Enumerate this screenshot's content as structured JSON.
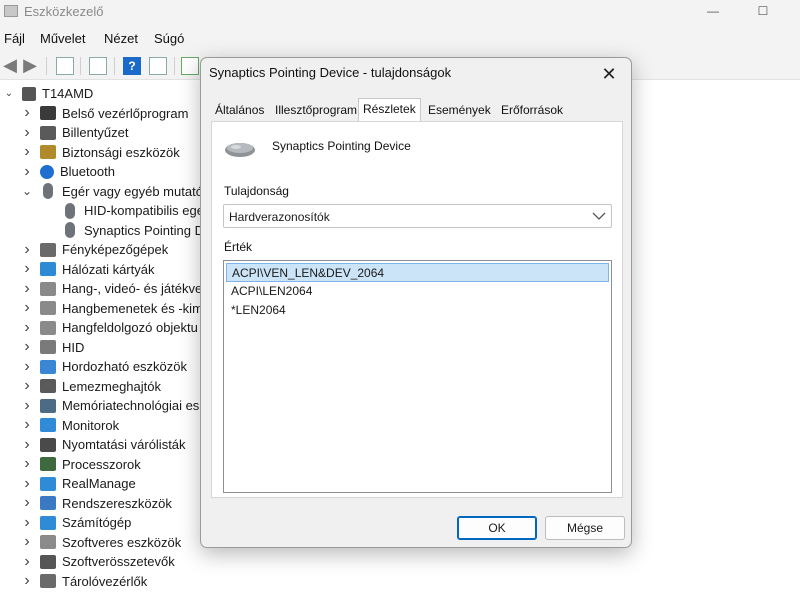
{
  "app": {
    "title": "Eszközkezelő"
  },
  "window_controls": {
    "minimize": "—",
    "maximize": "☐"
  },
  "menu": [
    "Fájl",
    "Művelet",
    "Nézet",
    "Súgó"
  ],
  "toolbar": {
    "help": "?"
  },
  "tree": {
    "root": "T14AMD",
    "items": [
      {
        "label": "Belső vezérlőprogram",
        "expanded": false,
        "icon": "firmware-icon"
      },
      {
        "label": "Billentyűzet",
        "expanded": false,
        "icon": "keyboard-icon"
      },
      {
        "label": "Biztonsági eszközök",
        "expanded": false,
        "icon": "security-device-icon"
      },
      {
        "label": "Bluetooth",
        "expanded": false,
        "icon": "bluetooth-icon"
      },
      {
        "label": "Egér vagy egyéb mutató",
        "expanded": true,
        "icon": "mouse-icon"
      },
      {
        "label": "HID-kompatibilis ege",
        "child": true,
        "icon": "mouse-icon"
      },
      {
        "label": "Synaptics Pointing D",
        "child": true,
        "icon": "mouse-icon"
      },
      {
        "label": "Fényképezőgépek",
        "expanded": false,
        "icon": "camera-icon"
      },
      {
        "label": "Hálózati kártyák",
        "expanded": false,
        "icon": "network-adapter-icon"
      },
      {
        "label": "Hang-, videó- és játékve",
        "expanded": false,
        "icon": "speaker-icon"
      },
      {
        "label": "Hangbemenetek és -kim",
        "expanded": false,
        "icon": "speaker-icon"
      },
      {
        "label": "Hangfeldolgozó objektu",
        "expanded": false,
        "icon": "speaker-icon"
      },
      {
        "label": "HID",
        "expanded": false,
        "icon": "hid-icon"
      },
      {
        "label": "Hordozható eszközök",
        "expanded": false,
        "icon": "portable-device-icon"
      },
      {
        "label": "Lemezmeghajtók",
        "expanded": false,
        "icon": "disk-drive-icon"
      },
      {
        "label": "Memóriatechnológiai es",
        "expanded": false,
        "icon": "memory-icon"
      },
      {
        "label": "Monitorok",
        "expanded": false,
        "icon": "monitor-icon"
      },
      {
        "label": "Nyomtatási várólisták",
        "expanded": false,
        "icon": "printer-icon"
      },
      {
        "label": "Processzorok",
        "expanded": false,
        "icon": "processor-icon"
      },
      {
        "label": "RealManage",
        "expanded": false,
        "icon": "monitor-icon"
      },
      {
        "label": "Rendszereszközök",
        "expanded": false,
        "icon": "system-device-icon"
      },
      {
        "label": "Számítógép",
        "expanded": false,
        "icon": "computer-icon"
      },
      {
        "label": "Szoftveres eszközök",
        "expanded": false,
        "icon": "software-device-icon"
      },
      {
        "label": "Szoftverösszetevők",
        "expanded": false,
        "icon": "software-component-icon"
      },
      {
        "label": "Tárolóvezérlők",
        "expanded": false,
        "icon": "storage-controller-icon"
      }
    ]
  },
  "dialog": {
    "title": "Synaptics Pointing Device - tulajdonságok",
    "close": "✕",
    "tabs": [
      "Általános",
      "Illesztőprogram",
      "Részletek",
      "Események",
      "Erőforrások"
    ],
    "active_tab": "Részletek",
    "device_name": "Synaptics Pointing Device",
    "property_label": "Tulajdonság",
    "property_value": "Hardverazonosítók",
    "value_label": "Érték",
    "values": [
      "ACPI\\VEN_LEN&DEV_2064",
      "ACPI\\LEN2064",
      "*LEN2064"
    ],
    "selected_value_index": 0,
    "ok": "OK",
    "cancel": "Mégse"
  },
  "colors": {
    "accent": "#0067c0",
    "selection": "#cce4f7",
    "window_bg": "#f0f0f0"
  }
}
